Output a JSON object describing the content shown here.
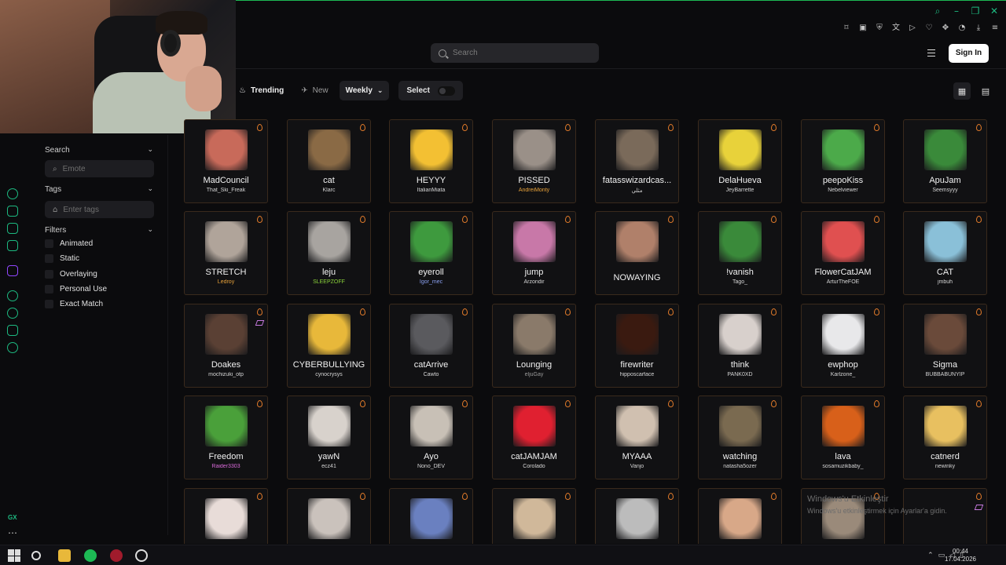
{
  "header": {
    "search_placeholder": "Search",
    "signin_label": "Sign In"
  },
  "toolbar": {
    "trending": "Trending",
    "new": "New",
    "period": "Weekly",
    "select": "Select"
  },
  "sidebar": {
    "search_title": "Search",
    "emote_placeholder": "Emote",
    "tags_title": "Tags",
    "tags_placeholder": "Enter tags",
    "filters_title": "Filters",
    "filters": [
      "Animated",
      "Static",
      "Overlaying",
      "Personal Use",
      "Exact Match"
    ]
  },
  "gx_label": "GX",
  "emotes": [
    {
      "name": "MadCouncil",
      "author": "That_Ski_Freak",
      "author_color": "#d5d5d5",
      "img": "#c86a5a"
    },
    {
      "name": "cat",
      "author": "Klarc",
      "author_color": "#d5d5d5",
      "img": "#8a6a45"
    },
    {
      "name": "HEYYY",
      "author": "ItalianMiata",
      "author_color": "#d5d5d5",
      "img": "#f3c033"
    },
    {
      "name": "PISSED",
      "author": "AndreiMonty",
      "author_color": "#e8a23a",
      "img": "#9a9088"
    },
    {
      "name": "fatasswizardcas...",
      "author": "مثلي",
      "author_color": "#d5d5d5",
      "img": "#7a6a5a"
    },
    {
      "name": "DelaHueva",
      "author": "JeyBarrette",
      "author_color": "#d5d5d5",
      "img": "#e8d23a"
    },
    {
      "name": "peepoKiss",
      "author": "Nebelviewer",
      "author_color": "#d5d5d5",
      "img": "#4caa4a"
    },
    {
      "name": "ApuJam",
      "author": "Seemsyyy",
      "author_color": "#d5d5d5",
      "img": "#3a8a3a"
    },
    {
      "name": "STRETCH",
      "author": "Ledroy",
      "author_color": "#e8a23a",
      "img": "#b0a49a"
    },
    {
      "name": "leju",
      "author": "SLEEPZOFF",
      "author_color": "#8ad23a",
      "img": "#a8a4a0"
    },
    {
      "name": "eyeroll",
      "author": "Igor_mec",
      "author_color": "#8aa0f0",
      "img": "#3e9a3e"
    },
    {
      "name": "jump",
      "author": "Arzondir",
      "author_color": "#d5d5d5",
      "img": "#c878a8"
    },
    {
      "name": "NOWAYING",
      "author": "",
      "author_color": "#d5d5d5",
      "img": "#b0806a"
    },
    {
      "name": "!vanish",
      "author": "Tago_",
      "author_color": "#d5d5d5",
      "img": "#3a8a3a"
    },
    {
      "name": "FlowerCatJAM",
      "author": "ArturTheFOE",
      "author_color": "#d5d5d5",
      "img": "#e05050"
    },
    {
      "name": "CAT",
      "author": "jmbuh",
      "author_color": "#d5d5d5",
      "img": "#8ac0d8"
    },
    {
      "name": "Doakes",
      "author": "mochizuki_otp",
      "author_color": "#d5d5d5",
      "img": "#5a4034",
      "layer": true
    },
    {
      "name": "CYBERBULLYING",
      "author": "cynocrysys",
      "author_color": "#d5d5d5",
      "img": "#e8b83a"
    },
    {
      "name": "catArrive",
      "author": "Cawto",
      "author_color": "#d5d5d5",
      "img": "#5a5a5e"
    },
    {
      "name": "Lounging",
      "author": "eljuGay",
      "author_color": "#9a9a9a",
      "img": "#8a7a6a"
    },
    {
      "name": "firewriter",
      "author": "hipposcarface",
      "author_color": "#d5d5d5",
      "img": "#3a1a10"
    },
    {
      "name": "think",
      "author": "PANK0XD",
      "author_color": "#d5d5d5",
      "img": "#d8d0cc"
    },
    {
      "name": "ewphop",
      "author": "Karlzone_",
      "author_color": "#d5d5d5",
      "img": "#e8e8ea"
    },
    {
      "name": "Sigma",
      "author": "BUBBABUNYIP",
      "author_color": "#d5d5d5",
      "img": "#6a4a3a"
    },
    {
      "name": "Freedom",
      "author": "Raider3303",
      "author_color": "#d86ad8",
      "img": "#4aa03a"
    },
    {
      "name": "yawN",
      "author": "ecz41",
      "author_color": "#d5d5d5",
      "img": "#d8d2cc"
    },
    {
      "name": "Ayo",
      "author": "Nono_DEV",
      "author_color": "#d5d5d5",
      "img": "#c8c0b6"
    },
    {
      "name": "catJAMJAM",
      "author": "Corolado",
      "author_color": "#d5d5d5",
      "img": "#e02030"
    },
    {
      "name": "MYAAA",
      "author": "Vanjo",
      "author_color": "#d5d5d5",
      "img": "#d0c0b0"
    },
    {
      "name": "watching",
      "author": "natasha5ozer",
      "author_color": "#d5d5d5",
      "img": "#7a6a50"
    },
    {
      "name": "lava",
      "author": "sosamuzikbaby_",
      "author_color": "#d5d5d5",
      "img": "#d8601a"
    },
    {
      "name": "catnerd",
      "author": "newinky",
      "author_color": "#d5d5d5",
      "img": "#e8c060"
    },
    {
      "name": "",
      "author": "",
      "author_color": "#d5d5d5",
      "img": "#e8dcd8"
    },
    {
      "name": "",
      "author": "",
      "author_color": "#d5d5d5",
      "img": "#cac2bc"
    },
    {
      "name": "",
      "author": "",
      "author_color": "#d5d5d5",
      "img": "#6a80c0"
    },
    {
      "name": "",
      "author": "",
      "author_color": "#d5d5d5",
      "img": "#d0b89a"
    },
    {
      "name": "",
      "author": "",
      "author_color": "#d5d5d5",
      "img": "#bcbcbc"
    },
    {
      "name": "",
      "author": "",
      "author_color": "#d5d5d5",
      "img": "#d8a888"
    },
    {
      "name": "",
      "author": "",
      "author_color": "#d5d5d5",
      "img": "#9a8a7a"
    },
    {
      "name": "",
      "author": "",
      "author_color": "#d5d5d5",
      "img": "",
      "layer": true
    }
  ],
  "watermark": {
    "line1": "Windows'u Etkinleştir",
    "line2": "Windows'u etkinleştirmek için Ayarlar'a gidin."
  },
  "taskbar": {
    "time": "00:44",
    "date": "17.04.2026"
  },
  "colors": {
    "accent": "#1db980",
    "card_border": "#3a2a1c",
    "flame": "#e07a2a"
  }
}
